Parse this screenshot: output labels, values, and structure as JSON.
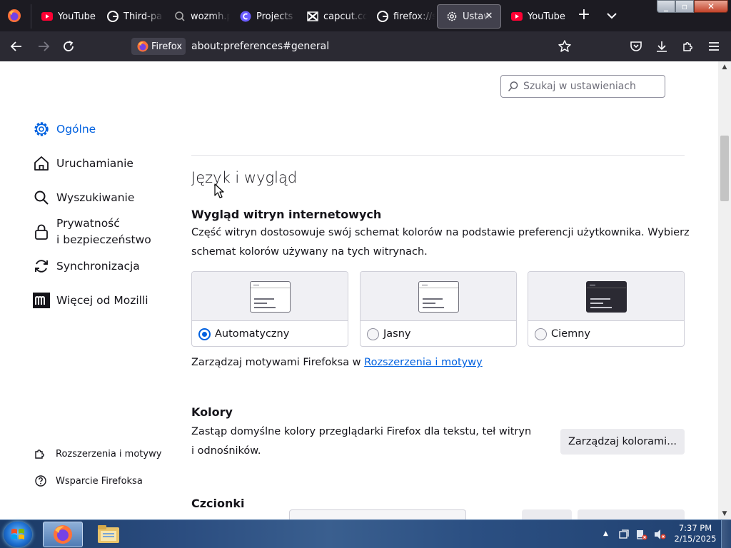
{
  "tabs": [
    {
      "title": "YouTube",
      "icon": "youtube-icon"
    },
    {
      "title": "Third-pa",
      "icon": "google-icon"
    },
    {
      "title": "wozmh.p",
      "icon": "search-icon"
    },
    {
      "title": "Projects",
      "icon": "projects-icon"
    },
    {
      "title": "capcut.co",
      "icon": "capcut-icon"
    },
    {
      "title": "firefox://s",
      "icon": "google-icon"
    },
    {
      "title": "Ustawi",
      "icon": "gear-icon",
      "active": true
    },
    {
      "title": "YouTube",
      "icon": "youtube-icon"
    }
  ],
  "navbar": {
    "identity_label": "Firefox",
    "url": "about:preferences#general"
  },
  "search": {
    "placeholder": "Szukaj w ustawieniach"
  },
  "sidebar": {
    "categories": [
      {
        "label": "Ogólne",
        "icon": "gear-icon",
        "selected": true
      },
      {
        "label": "Uruchamianie",
        "icon": "home-icon"
      },
      {
        "label": "Wyszukiwanie",
        "icon": "search-icon"
      },
      {
        "label_line1": "Prywatność",
        "label_line2": "i bezpieczeństwo",
        "icon": "lock-icon"
      },
      {
        "label": "Synchronizacja",
        "icon": "sync-icon"
      },
      {
        "label": "Więcej od Mozilli",
        "icon": "mozilla-icon"
      }
    ],
    "footer": [
      {
        "label": "Rozszerzenia i motywy",
        "icon": "puzzle-icon"
      },
      {
        "label": "Wsparcie Firefoksa",
        "icon": "help-icon"
      }
    ]
  },
  "main": {
    "section_title": "Język i wygląd",
    "appearance": {
      "heading": "Wygląd witryn internetowych",
      "description_line1": "Część witryn dostosowuje swój schemat kolorów na podstawie preferencji użytkownika. Wybierz",
      "description_line2": "schemat kolorów używany na tych witrynach.",
      "options": [
        {
          "label": "Automatyczny",
          "checked": true
        },
        {
          "label": "Jasny",
          "checked": false
        },
        {
          "label": "Ciemny",
          "checked": false
        }
      ],
      "themes_text": "Zarządzaj motywami Firefoksa w",
      "themes_link": "Rozszerzenia i motywy"
    },
    "colors": {
      "heading": "Kolory",
      "description_line1": "Zastąp domyślne kolory przeglądarki Firefox dla tekstu, teł witryn",
      "description_line2": "i odnośników.",
      "button_label": "Zarządzaj kolorami..."
    },
    "fonts": {
      "heading": "Czcionki"
    }
  },
  "taskbar": {
    "clock_time": "7:37 PM",
    "clock_date": "2/15/2025"
  },
  "colors": {
    "accent": "#0061e0",
    "chrome_dark": "#1c1b22",
    "toolbar": "#2b2a33"
  }
}
